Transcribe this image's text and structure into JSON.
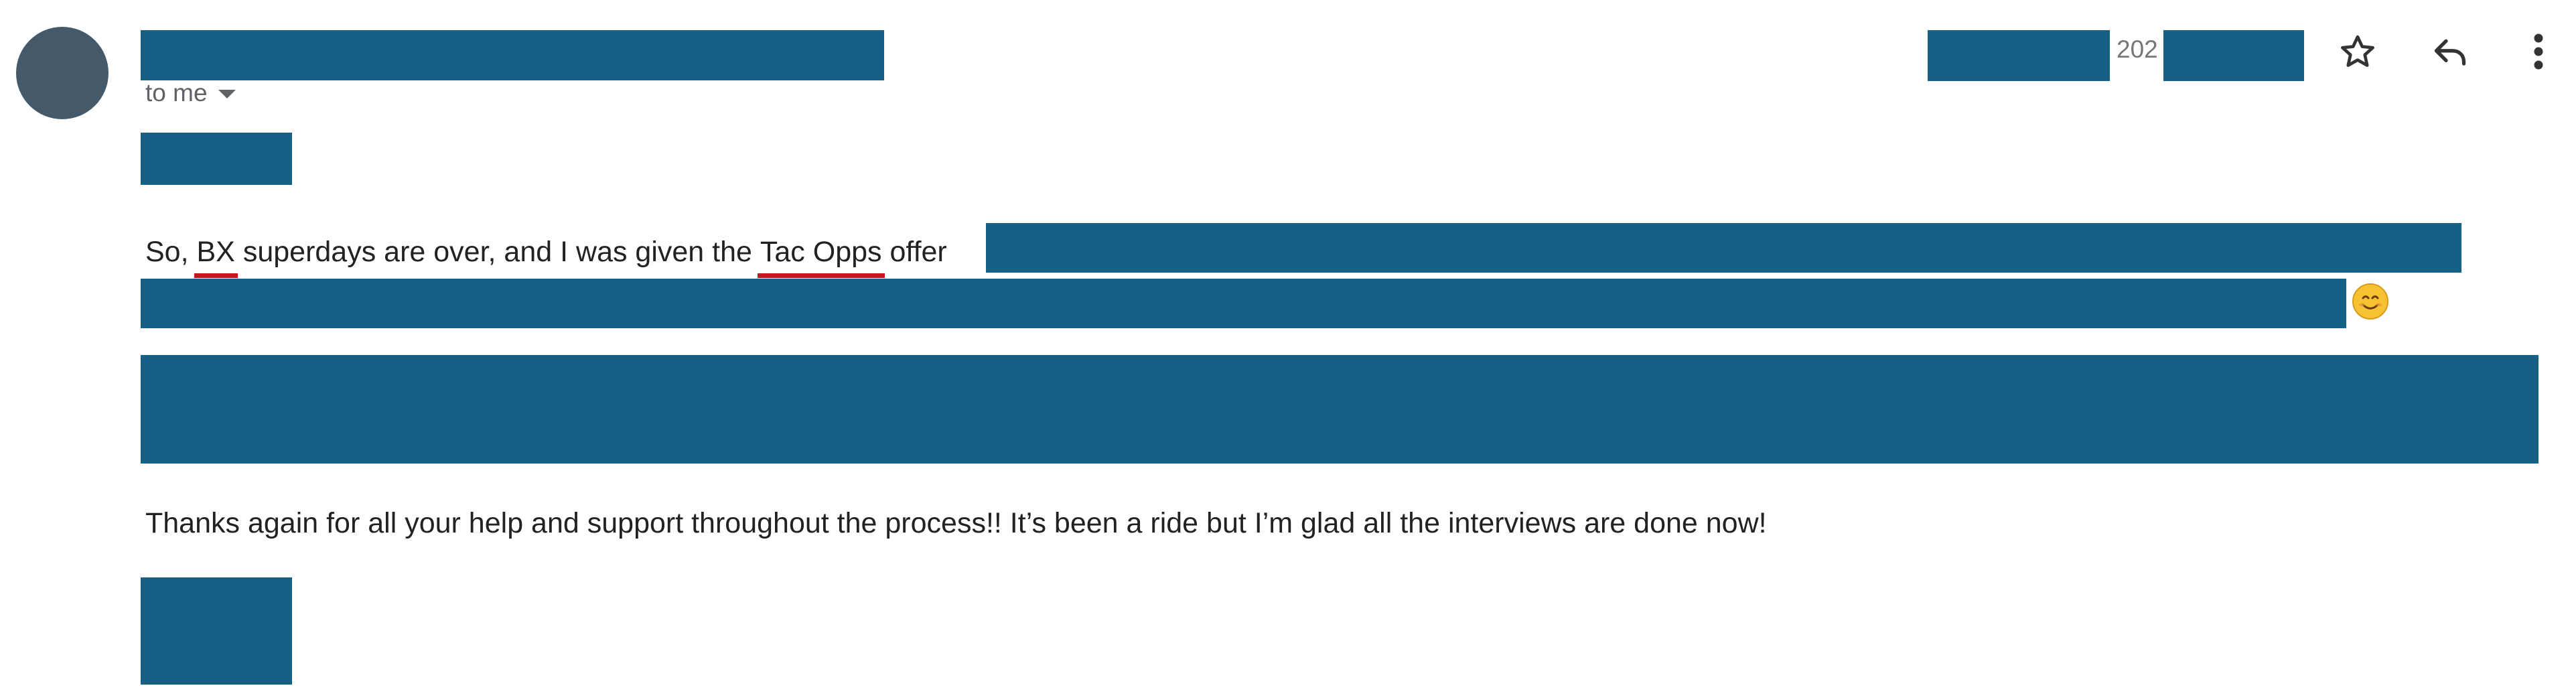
{
  "header": {
    "recipient_label": "to me",
    "date_fragment": "202"
  },
  "toolbar": {
    "star_icon": "star-outline-icon",
    "reply_icon": "reply-icon",
    "more_icon": "more-vert-icon"
  },
  "message": {
    "line1": {
      "part1": "So, ",
      "link1": "BX",
      "part2": " superdays are over, and I was given the ",
      "link2": "Tac Opps",
      "part3": " offer"
    },
    "emoji": "smiling-face-icon",
    "closing": "Thanks again for all your help and support throughout the process!! It’s been a ride but I’m glad all the interviews are done now!"
  },
  "colors": {
    "redaction": "#176085",
    "avatar": "#44596a",
    "spellcheck_underline": "#c7161e",
    "muted_text": "#5f6368"
  }
}
